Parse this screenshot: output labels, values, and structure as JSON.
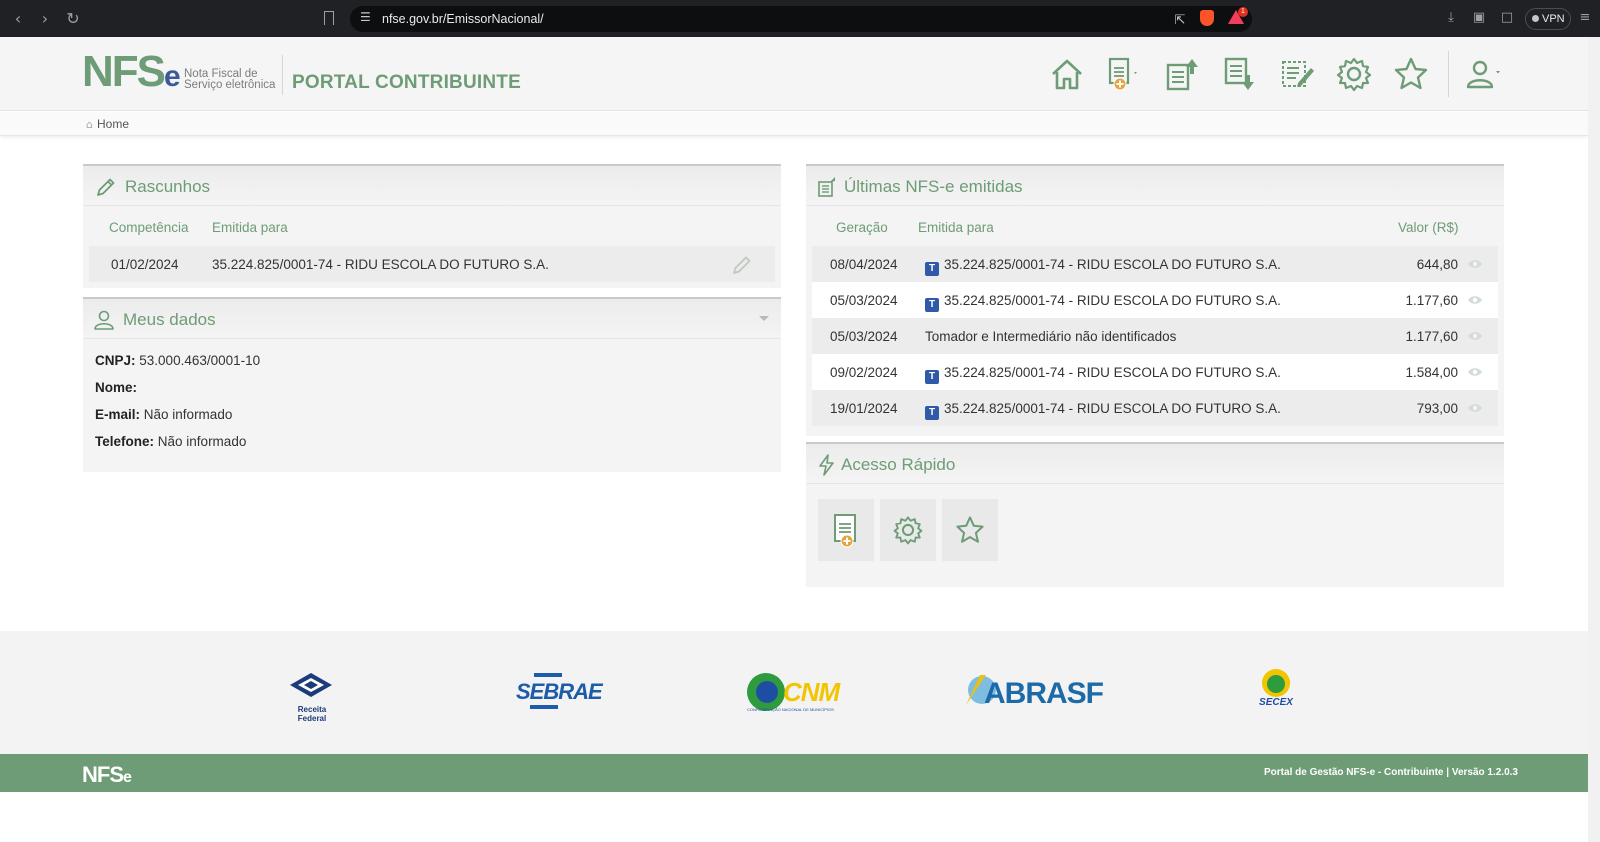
{
  "browser": {
    "url": "nfse.gov.br/EmissorNacional/",
    "vpn_label": "VPN",
    "rewards_count": "1"
  },
  "header": {
    "logo_main": "NFS",
    "logo_e": "e",
    "logo_subtitle_line1": "Nota Fiscal de",
    "logo_subtitle_line2": "Serviço eletrônica",
    "portal_title": "PORTAL CONTRIBUINTE",
    "icons": [
      "home-icon",
      "new-nfse-icon",
      "issued-upload-icon",
      "received-download-icon",
      "edit-list-icon",
      "settings-gear-icon",
      "favorites-star-icon",
      "user-icon"
    ]
  },
  "breadcrumb": {
    "home": "Home"
  },
  "rascunhos": {
    "title": "Rascunhos",
    "headers": [
      "Competência",
      "Emitida para"
    ],
    "rows": [
      {
        "competencia": "01/02/2024",
        "emitida_para": "35.224.825/0001-74 - RIDU ESCOLA DO FUTURO S.A."
      }
    ]
  },
  "meus_dados": {
    "title": "Meus dados",
    "cnpj_label": "CNPJ:",
    "cnpj_value": "53.000.463/0001-10",
    "nome_label": "Nome:",
    "nome_value": "",
    "email_label": "E-mail:",
    "email_value": "Não informado",
    "telefone_label": "Telefone:",
    "telefone_value": "Não informado"
  },
  "ultimas": {
    "title": "Últimas NFS-e emitidas",
    "headers": [
      "Geração",
      "Emitida para",
      "Valor (R$)"
    ],
    "badge": "T",
    "rows": [
      {
        "geracao": "08/04/2024",
        "badge": true,
        "emitida_para": "35.224.825/0001-74 - RIDU ESCOLA DO FUTURO S.A.",
        "valor": "644,80"
      },
      {
        "geracao": "05/03/2024",
        "badge": true,
        "emitida_para": "35.224.825/0001-74 - RIDU ESCOLA DO FUTURO S.A.",
        "valor": "1.177,60"
      },
      {
        "geracao": "05/03/2024",
        "badge": false,
        "emitida_para": "Tomador e Intermediário não identificados",
        "valor": "1.177,60"
      },
      {
        "geracao": "09/02/2024",
        "badge": true,
        "emitida_para": "35.224.825/0001-74 - RIDU ESCOLA DO FUTURO S.A.",
        "valor": "1.584,00"
      },
      {
        "geracao": "19/01/2024",
        "badge": true,
        "emitida_para": "35.224.825/0001-74 - RIDU ESCOLA DO FUTURO S.A.",
        "valor": "793,00"
      }
    ]
  },
  "acesso_rapido": {
    "title": "Acesso Rápido",
    "tiles": [
      "new-nfse-icon",
      "settings-gear-icon",
      "favorites-star-icon"
    ]
  },
  "partners": {
    "receita": "Receita Federal",
    "sebrae": "SEBRAE",
    "cnm": "CNM",
    "cnm_sub": "CONFEDERAÇÃO NACIONAL DE MUNICÍPIOS",
    "abrasf": "ABRASF",
    "secex": "SECEX"
  },
  "footer": {
    "logo_main": "NFS",
    "logo_e": "e",
    "version_text": "Portal de Gestão NFS-e - Contribuinte | Versão 1.2.0.3"
  },
  "colors": {
    "brand_green": "#6e9c76",
    "brand_blue": "#2e5aa8"
  }
}
